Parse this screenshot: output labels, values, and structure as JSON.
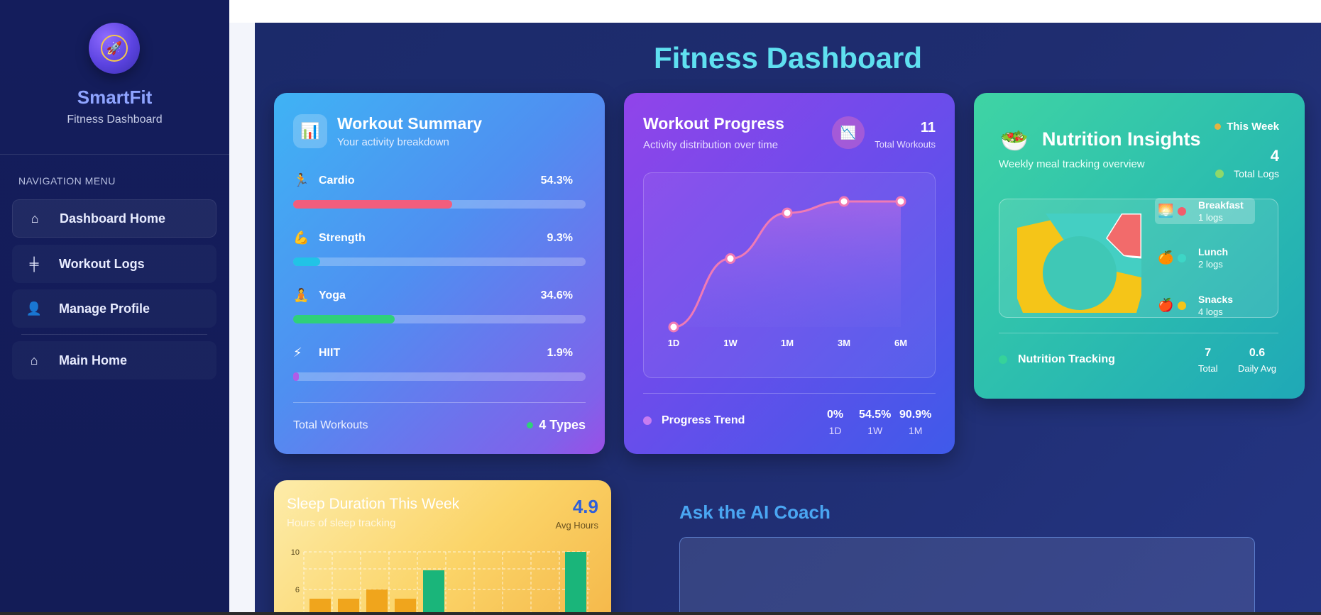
{
  "sidebar": {
    "brand": "SmartFit",
    "brand_sub": "Fitness Dashboard",
    "nav_title": "NAVIGATION MENU",
    "items": [
      {
        "label": "Dashboard Home",
        "icon": "home-icon",
        "glyph": "⌂"
      },
      {
        "label": "Workout Logs",
        "icon": "dumbbell-icon",
        "glyph": "╪"
      },
      {
        "label": "Manage Profile",
        "icon": "user-icon",
        "glyph": "👤"
      },
      {
        "label": "Main Home",
        "icon": "home-icon",
        "glyph": "⌂"
      }
    ]
  },
  "main": {
    "title": "Fitness Dashboard"
  },
  "workout_summary": {
    "title": "Workout Summary",
    "subtitle": "Your activity breakdown",
    "rows": [
      {
        "label": "Cardio",
        "pct": "54.3%",
        "value": 54.3,
        "color": "#f25d7d",
        "icon": "🏃"
      },
      {
        "label": "Strength",
        "pct": "9.3%",
        "value": 9.3,
        "color": "#22c3e6",
        "icon": "💪"
      },
      {
        "label": "Yoga",
        "pct": "34.6%",
        "value": 34.6,
        "color": "#2fd07a",
        "icon": "🧘"
      },
      {
        "label": "HIIT",
        "pct": "1.9%",
        "value": 1.9,
        "color": "#b05be8",
        "icon": "⚡"
      }
    ],
    "footer_label": "Total Workouts",
    "footer_value": "4 Types"
  },
  "workout_progress": {
    "title": "Workout Progress",
    "subtitle": "Activity distribution over time",
    "total": "11",
    "total_label": "Total Workouts",
    "trend_label": "Progress Trend",
    "stats": [
      {
        "v": "0%",
        "k": "1D"
      },
      {
        "v": "54.5%",
        "k": "1W"
      },
      {
        "v": "90.9%",
        "k": "1M"
      }
    ]
  },
  "chart_data": {
    "type": "line",
    "categories": [
      "1D",
      "1W",
      "1M",
      "3M",
      "6M"
    ],
    "values": [
      0,
      54.5,
      90.9,
      100,
      100
    ],
    "ylim": [
      0,
      100
    ]
  },
  "nutrition": {
    "title": "Nutrition Insights",
    "subtitle": "Weekly meal tracking overview",
    "week_label": "This Week",
    "total_logs": "4",
    "total_logs_label": "Total Logs",
    "legend": [
      {
        "name": "Breakfast",
        "count": "1 logs",
        "color": "#f25d6b",
        "emoji": "🌅"
      },
      {
        "name": "Lunch",
        "count": "2 logs",
        "color": "#3dd6c6",
        "emoji": "🍊"
      },
      {
        "name": "Snacks",
        "count": "4 logs",
        "color": "#f5c518",
        "emoji": "🍎"
      }
    ],
    "tracking_label": "Nutrition Tracking",
    "stats": [
      {
        "v": "7",
        "k": "Total"
      },
      {
        "v": "0.6",
        "k": "Daily Avg"
      }
    ]
  },
  "sleep": {
    "title": "Sleep Duration This Week",
    "subtitle": "Hours of sleep tracking",
    "avg": "4.9",
    "avg_label": "Avg Hours",
    "y_ticks": [
      "10",
      "6"
    ]
  },
  "ai_coach": {
    "title": "Ask the AI Coach"
  }
}
